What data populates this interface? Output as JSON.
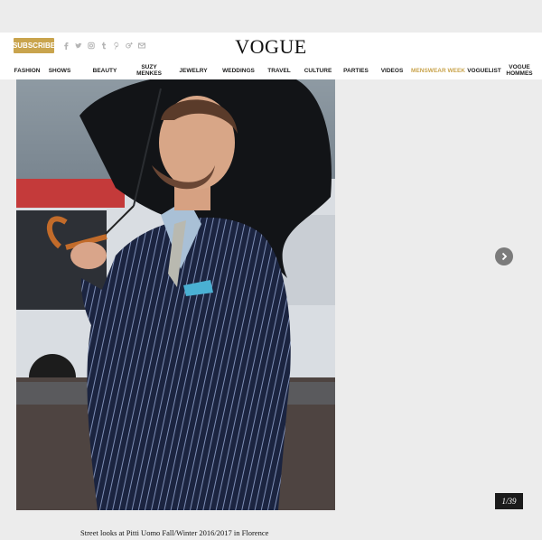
{
  "header": {
    "subscribe_label": "SUBSCRIBE",
    "logo": "VOGUE",
    "social_icons": [
      "facebook-icon",
      "twitter-icon",
      "instagram-icon",
      "tumblr-icon",
      "pinterest-icon",
      "google-plus-icon",
      "mail-icon"
    ]
  },
  "nav": {
    "items": [
      {
        "label": "FASHION"
      },
      {
        "label": "SHOWS"
      },
      {
        "label": "BEAUTY"
      },
      {
        "label": "SUZY\nMENKES"
      },
      {
        "label": "JEWELRY"
      },
      {
        "label": "WEDDINGS"
      },
      {
        "label": "TRAVEL"
      },
      {
        "label": "CULTURE"
      },
      {
        "label": "PARTIES"
      },
      {
        "label": "VIDEOS"
      },
      {
        "label": "MENSWEAR WEEK"
      },
      {
        "label": "VOGUELIST"
      },
      {
        "label": "VOGUE\nHOMMES"
      }
    ]
  },
  "gallery": {
    "counter": "1/39",
    "caption": "Street looks at Pitti Uomo Fall/Winter 2016/2017 in Florence"
  },
  "colors": {
    "accent": "#c9a44d",
    "page_bg": "#ececec",
    "suit": "#1b2440"
  }
}
